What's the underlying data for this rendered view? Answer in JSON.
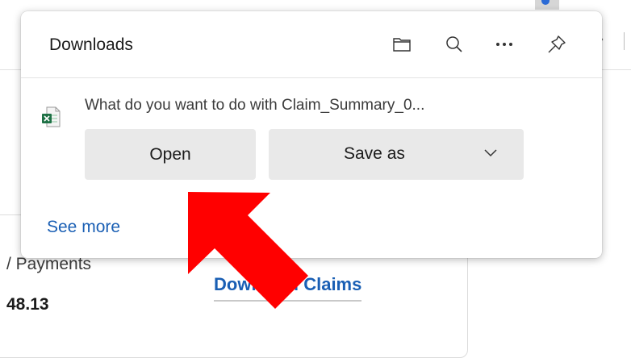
{
  "background": {
    "payments_label": "/ Payments",
    "payments_value": "48.13",
    "download_claims_link": "Download Claims"
  },
  "downloads_panel": {
    "title": "Downloads",
    "header_icons": [
      "folder-icon",
      "search-icon",
      "more-icon",
      "pin-icon"
    ],
    "file_icon": "excel-file-icon",
    "prompt": "What do you want to do with Claim_Summary_0...",
    "open_label": "Open",
    "save_as_label": "Save as",
    "see_more_label": "See more"
  },
  "colors": {
    "accent_link": "#1a5fb4",
    "button_bg": "#e9e9e9",
    "annotation_arrow": "#ff0000",
    "excel_green": "#1e7145"
  }
}
